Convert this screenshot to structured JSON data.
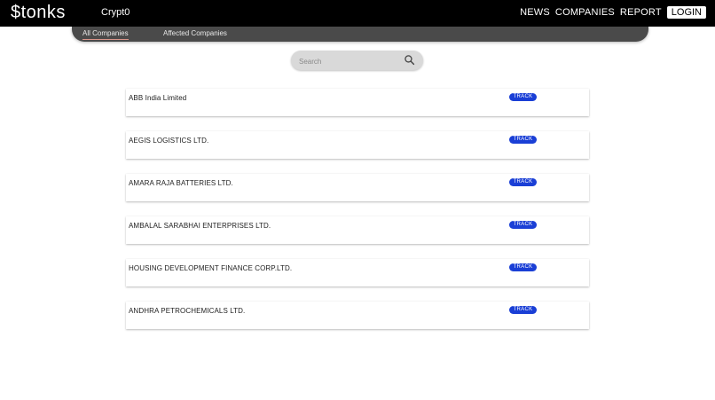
{
  "header": {
    "logo": "$tonks",
    "crypto_label": "Crypt0",
    "nav": [
      "NEWS",
      "COMPANIES",
      "REPORT"
    ],
    "login_label": "LOGIN"
  },
  "tabs": {
    "all_label": "All Companies",
    "affected_label": "Affected Companies",
    "active": "All Companies"
  },
  "search": {
    "placeholder": "Search",
    "value": ""
  },
  "companies": [
    {
      "name": "ABB India Limited",
      "action": "TRACK"
    },
    {
      "name": "AEGIS LOGISTICS LTD.",
      "action": "TRACK"
    },
    {
      "name": "AMARA RAJA BATTERIES LTD.",
      "action": "TRACK"
    },
    {
      "name": "AMBALAL SARABHAI ENTERPRISES LTD.",
      "action": "TRACK"
    },
    {
      "name": "HOUSING DEVELOPMENT FINANCE CORP.LTD.",
      "action": "TRACK"
    },
    {
      "name": "ANDHRA PETROCHEMICALS LTD.",
      "action": "TRACK"
    }
  ],
  "colors": {
    "navbar_bg": "#000000",
    "tabbar_bg": "#4a4a4a",
    "track_button": "#1a3fd6",
    "active_tab_underline": "#d9958a",
    "search_bg": "#d9d9d9"
  }
}
